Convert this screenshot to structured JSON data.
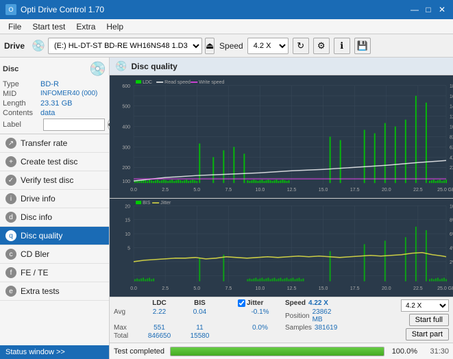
{
  "app": {
    "title": "Opti Drive Control 1.70",
    "icon": "O"
  },
  "title_controls": {
    "minimize": "—",
    "maximize": "□",
    "close": "✕"
  },
  "menu": {
    "items": [
      "File",
      "Start test",
      "Extra",
      "Help"
    ]
  },
  "toolbar": {
    "drive_label": "Drive",
    "drive_value": "(E:)  HL-DT-ST BD-RE  WH16NS48 1.D3",
    "speed_label": "Speed",
    "speed_value": "4.2 X"
  },
  "disc": {
    "type_label": "Type",
    "type_value": "BD-R",
    "mid_label": "MID",
    "mid_value": "INFOMER40 (000)",
    "length_label": "Length",
    "length_value": "23.31 GB",
    "contents_label": "Contents",
    "contents_value": "data",
    "label_label": "Label",
    "label_value": ""
  },
  "nav": {
    "items": [
      {
        "id": "transfer-rate",
        "label": "Transfer rate",
        "icon": "↗"
      },
      {
        "id": "create-test-disc",
        "label": "Create test disc",
        "icon": "+"
      },
      {
        "id": "verify-test-disc",
        "label": "Verify test disc",
        "icon": "✓"
      },
      {
        "id": "drive-info",
        "label": "Drive info",
        "icon": "i"
      },
      {
        "id": "disc-info",
        "label": "Disc info",
        "icon": "d"
      },
      {
        "id": "disc-quality",
        "label": "Disc quality",
        "icon": "q",
        "active": true
      },
      {
        "id": "cd-bler",
        "label": "CD Bler",
        "icon": "c"
      },
      {
        "id": "fe-te",
        "label": "FE / TE",
        "icon": "f"
      },
      {
        "id": "extra-tests",
        "label": "Extra tests",
        "icon": "e"
      }
    ]
  },
  "status_window": {
    "label": "Status window >> "
  },
  "disc_quality": {
    "title": "Disc quality",
    "legend_ldc": "LDC",
    "legend_read": "Read speed",
    "legend_write": "Write speed",
    "legend_bis": "BIS",
    "legend_jitter": "Jitter"
  },
  "stats": {
    "headers": [
      "",
      "LDC",
      "BIS",
      "",
      "Jitter",
      "Speed",
      ""
    ],
    "avg_label": "Avg",
    "avg_ldc": "2.22",
    "avg_bis": "0.04",
    "avg_jitter": "-0.1%",
    "max_label": "Max",
    "max_ldc": "551",
    "max_bis": "11",
    "max_jitter": "0.0%",
    "total_label": "Total",
    "total_ldc": "846650",
    "total_bis": "15580",
    "speed_label": "Speed",
    "speed_value": "4.22 X",
    "position_label": "Position",
    "position_value": "23862 MB",
    "samples_label": "Samples",
    "samples_value": "381619",
    "speed_select": "4.2 X",
    "start_full": "Start full",
    "start_part": "Start part",
    "jitter_checked": true,
    "jitter_label": "Jitter"
  },
  "progress": {
    "status_text": "Test completed",
    "percent": 100,
    "percent_text": "100.0%",
    "time": "31:30"
  }
}
